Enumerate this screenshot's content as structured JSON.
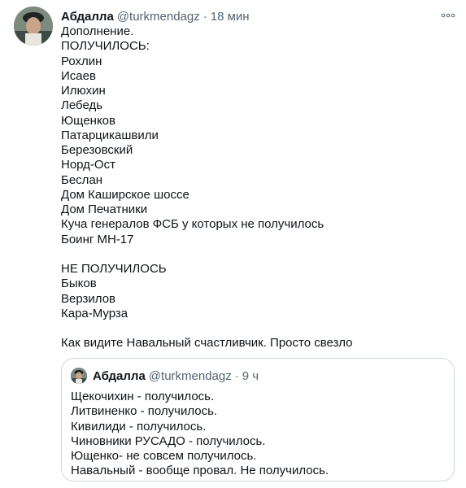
{
  "tweet": {
    "author": {
      "name": "Абдалла",
      "handle": "@turkmendagz",
      "separator": "·",
      "time": "18 мин"
    },
    "lines": [
      "Дополнение.",
      "ПОЛУЧИЛОСЬ:",
      "Рохлин",
      "Исаев",
      "Илюхин",
      "Лебедь",
      "Ющенков",
      "Патарцикашвили",
      "Березовский",
      "Норд-Ост",
      "Беслан",
      "Дом Каширское шоссе",
      "Дом Печатники",
      "Куча генералов ФСБ у которых не получилось",
      "Боинг МН-17",
      "",
      "НЕ ПОЛУЧИЛОСЬ",
      "Быков",
      "Верзилов",
      "Кара-Мурза",
      "",
      "Как видите Навальный счастливчик. Просто свезло"
    ],
    "more_icon": "ellipsis-icon"
  },
  "quoted_tweet": {
    "author": {
      "name": "Абдалла",
      "handle": "@turkmendagz",
      "separator": "·",
      "time": "9 ч"
    },
    "lines": [
      "Щекочихин - получилось.",
      "Литвиненко - получилось.",
      "Кивилиди - получилось.",
      "Чиновники РУСАДО - получилось.",
      "Ющенко- не совсем получилось.",
      "Навальный - вообще провал. Не получилось."
    ]
  },
  "colors": {
    "text": "#0f1419",
    "secondary": "#536471",
    "border": "#cfd9de"
  }
}
